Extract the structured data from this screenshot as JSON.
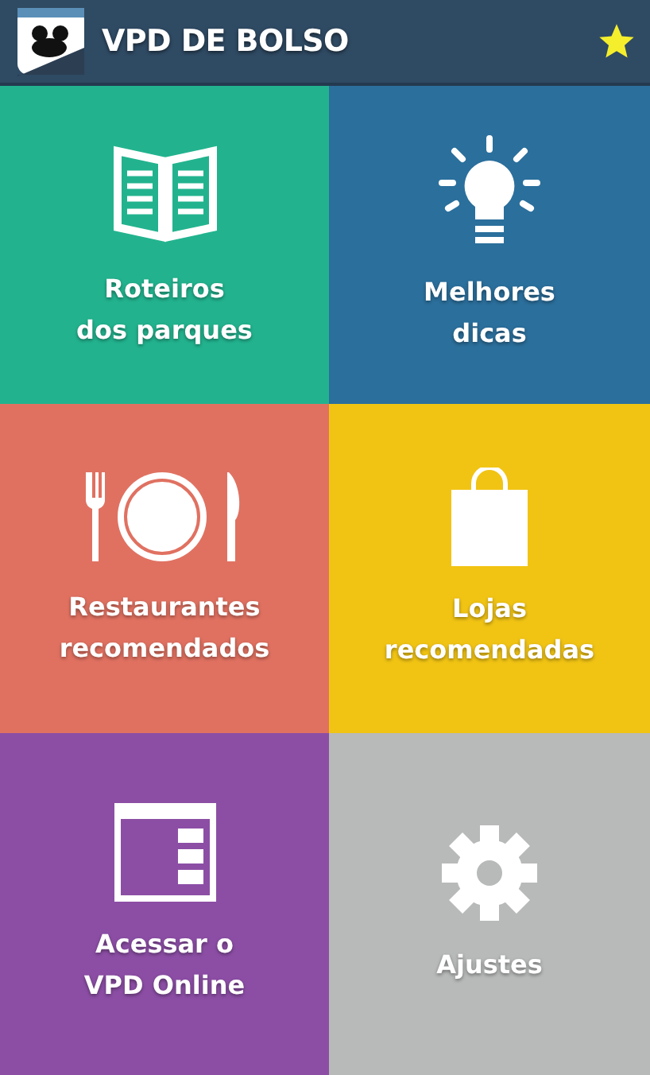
{
  "app_bar": {
    "title": "VPD DE BOLSO",
    "favorite": true
  },
  "tiles": [
    {
      "lines": [
        "Roteiros",
        "dos parques"
      ],
      "color": "#22b38e"
    },
    {
      "lines": [
        "Melhores",
        "dicas"
      ],
      "color": "#2b6f9c"
    },
    {
      "lines": [
        "Restaurantes",
        "recomendados"
      ],
      "color": "#e07161"
    },
    {
      "lines": [
        "Lojas",
        "recomendadas"
      ],
      "color": "#f1c414"
    },
    {
      "lines": [
        "Acessar o",
        "VPD Online"
      ],
      "color": "#8c4ea5"
    },
    {
      "lines": [
        "Ajustes"
      ],
      "color": "#b8b9b9"
    }
  ]
}
